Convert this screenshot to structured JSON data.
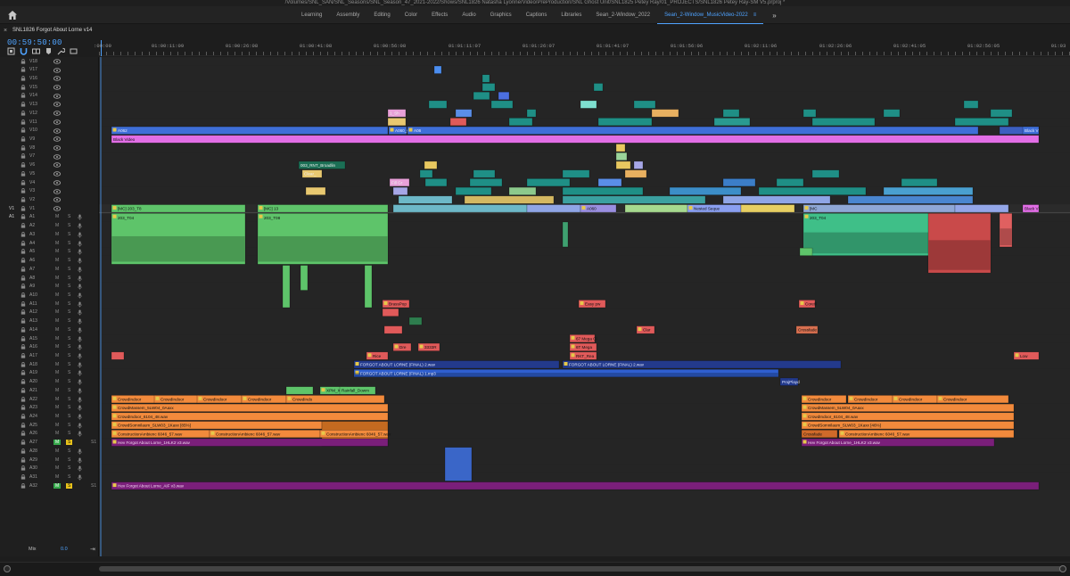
{
  "window": {
    "path_title": "/Volumes/SNL_SAN/SNL_Seasons/SNL_Season_47_2021-2022/Shows/SNL1826 Natasha Lyonne/Video/PreProduction/SNL Ghost Unit/SNL1825 Petey Ray/01_PROJECTS/SNL1826 Petey Ray-SM V5.prproj *"
  },
  "workspaces": {
    "tabs": [
      "Learning",
      "Assembly",
      "Editing",
      "Color",
      "Effects",
      "Audio",
      "Graphics",
      "Captions",
      "Libraries",
      "Sean_2-Window_2022",
      "Sean_2-Window_MusicVideo-2022"
    ],
    "active_index": 10,
    "more_label": "»",
    "menu_glyph": "≡"
  },
  "sequence": {
    "close_glyph": "×",
    "name": "SNL1826 Forgot About Lorne v14",
    "timecode": "00:59:50:00"
  },
  "ruler": {
    "start_label": ":00:09",
    "labels": [
      "01:00:11:09",
      "01:00:26:08",
      "01:00:41:08",
      "01:00:56:08",
      "01:01:11:07",
      "01:01:26:07",
      "01:01:41:07",
      "01:01:56:06",
      "01:02:11:06",
      "01:02:26:06",
      "01:02:41:05",
      "01:02:56:05",
      "01:03"
    ]
  },
  "video_tracks": [
    "V18",
    "V17",
    "V16",
    "V15",
    "V14",
    "V13",
    "V12",
    "V11",
    "V10",
    "V9",
    "V8",
    "V7",
    "V6",
    "V5",
    "V4",
    "V3",
    "V2",
    "V1"
  ],
  "audio_tracks": [
    "A1",
    "A2",
    "A3",
    "A4",
    "A5",
    "A6",
    "A7",
    "A8",
    "A9",
    "A10",
    "A11",
    "A12",
    "A13",
    "A14",
    "A15",
    "A16",
    "A17",
    "A18",
    "A19",
    "A20",
    "A21",
    "A22",
    "A23",
    "A24",
    "A25",
    "A26",
    "A27",
    "A28",
    "A29",
    "A30",
    "A31",
    "A32"
  ],
  "source_patch": {
    "video": "V1",
    "audio": "A1"
  },
  "track_controls": {
    "mute": "M",
    "solo": "S"
  },
  "highlighted_audio": {
    "A27": {
      "mute": "M",
      "solo": "S",
      "volume": "S1"
    },
    "A32": {
      "mute": "M",
      "solo": "S",
      "volume": "S1"
    }
  },
  "mix": {
    "label": "Mix",
    "value": "0.0",
    "end_glyph": "⇥"
  },
  "clip_labels": {
    "v10_a": "A062",
    "v10_b": "A060_C0",
    "v10_c": "A06",
    "v10_end": "Black V",
    "v9": "Black Video",
    "v1_a": "[MC] 203_T8",
    "v1_b": "[MC] 13",
    "v1_c": "A060",
    "v1_d": "Nested Seque",
    "v1_e": "[MC",
    "v1_end": "Black V",
    "v12_a": "1_Sh",
    "v6_a": "003_RNT_Broadlin",
    "v5_a": "Clear_",
    "v4_a": "Fill Gr",
    "a1_a": "203_T04",
    "a1_b": "203_T08",
    "a1_c": "203_T03",
    "a1_d": "203_T03",
    "a1_e": "203_T04",
    "a11_a": "BrassPop",
    "a11_b": "Easy pw",
    "a11_c": "Coretll",
    "a14_a": "Clar",
    "a14_b": "Crossfade",
    "a15_a": "67 Mega Cl",
    "a16_a": "Dre",
    "a16_b": "3333R",
    "a16_c": "6T Mega",
    "a17_a": "Rice",
    "a17_b": "RKT_Rea",
    "a17_c": "Low",
    "a18_a": "FORGOT ABOUT LORNE (FINAL) 2.wav",
    "a18_b": "FORGOT ABOUT LORNE (FINAL) 2.wav",
    "a19_a": "FORGOT ABOUT LORNE (FINAL) 1.mp3",
    "a20_a": "ProjPlayd",
    "a21_a": "XPM_XPM_Ut",
    "a21_b": "Rainfall_Dowm",
    "a22_a": "CrowdIndoor",
    "a22_b": "CrowdIndoor",
    "a22_c": "CrowdIndoor",
    "a22_d": "CrowdIndoor",
    "a22_e": "CrowdIndo",
    "a22_f": "CrowdIndoor",
    "a22_g": "CrowdIndoor",
    "a22_h": "CrowdIndoor",
    "a22_i": "CrowdIndoor",
    "a23_a": "CrowdMassem_5LW04_0Aaxx",
    "a23_b": "CrowdMassem_5LW04_0Aaxx",
    "a24_a": "CrowdIndoor_6104_48.wav",
    "a24_b": "CrowdIndoor_6104_48.wav",
    "a25_a": "CrowdSomnilaum_SLW03_1Kaxx [85%]",
    "a25_b": "CrowdSomnilaum_SLW03_1Kaxx [46%]",
    "a26_a": "ConstructionAmbienc 6046_57.wav",
    "a26_b": "ConstructionAmbienc 6046_57.wav",
    "a26_c": "ConstructionAmbienc 6046_57.wav",
    "a26_d": "ConstructionAmbienc 6046_57.wav",
    "a26_e": "Crossfade",
    "a27_a": "Hev Forgot About Lorne_1HLK2 v3.wav",
    "a27_b": "Hev Forgot About Lorne_1HLK2 v3.wav",
    "a32_a": "Hev Forgot About Lorne_AIF v3.wav"
  },
  "colors": {
    "accent": "#4fa3ff",
    "clip_blue": "#3f6fd8",
    "clip_pink": "#e26ee6",
    "clip_green": "#5ec46a",
    "clip_teal": "#1f8f86",
    "clip_orange": "#f28a3c",
    "clip_red": "#e05a5a",
    "clip_navy": "#233a8c",
    "clip_purple": "#7a1f7a",
    "clip_lavender": "#9a8ee0"
  }
}
